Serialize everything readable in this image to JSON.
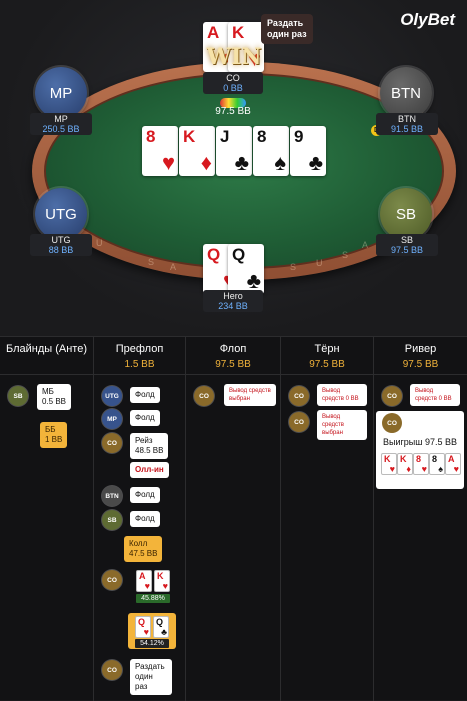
{
  "brand": "OlyBet",
  "table": {
    "win_label": "WIN",
    "deal_once_tip": "Раздать один раз",
    "pot": "97.5 BB",
    "rim_letters": [
      "U",
      "S",
      "A",
      "S",
      "U",
      "S",
      "A"
    ],
    "board": [
      {
        "rank": "8",
        "suit": "♥",
        "color": "red"
      },
      {
        "rank": "K",
        "suit": "♦",
        "color": "red"
      },
      {
        "rank": "J",
        "suit": "♣",
        "color": "black"
      },
      {
        "rank": "8",
        "suit": "♠",
        "color": "black"
      },
      {
        "rank": "9",
        "suit": "♣",
        "color": "black"
      }
    ],
    "co_cards": [
      {
        "rank": "A",
        "suit": "♥",
        "color": "red"
      },
      {
        "rank": "K",
        "suit": "♥",
        "color": "red"
      }
    ],
    "hero_cards": [
      {
        "rank": "Q",
        "suit": "♥",
        "color": "red"
      },
      {
        "rank": "Q",
        "suit": "♣",
        "color": "black"
      }
    ],
    "seats": {
      "co": {
        "name": "CO",
        "stack": "0 BB"
      },
      "mp": {
        "label": "MP",
        "name": "MP",
        "stack": "250.5 BB"
      },
      "btn": {
        "label": "BTN",
        "name": "BTN",
        "stack": "91.5 BB",
        "dealer": "D"
      },
      "utg": {
        "label": "UTG",
        "name": "UTG",
        "stack": "88 BB"
      },
      "sb": {
        "label": "SB",
        "name": "SB",
        "stack": "97.5 BB"
      },
      "hero": {
        "name": "Hero",
        "stack": "234 BB"
      }
    }
  },
  "history": {
    "columns": [
      {
        "title": "Блайнды (Анте)",
        "pot": ""
      },
      {
        "title": "Префлоп",
        "pot": "1.5 BB"
      },
      {
        "title": "Флоп",
        "pot": "97.5 BB"
      },
      {
        "title": "Тёрн",
        "pot": "97.5 BB"
      },
      {
        "title": "Ривер",
        "pot": "97.5 BB"
      }
    ],
    "blinds": {
      "sb_pos": "SB",
      "sb_action": "МБ",
      "sb_amount": "0.5 BB",
      "bb_action": "ББ",
      "bb_amount": "1 BB"
    },
    "preflop": {
      "utg": {
        "pos": "UTG",
        "action": "Фолд"
      },
      "mp": {
        "pos": "MP",
        "action": "Фолд"
      },
      "co": {
        "pos": "CO",
        "action": "Рейз",
        "amount": "48.5 BB",
        "allin": "Олл-ин"
      },
      "btn": {
        "pos": "BTN",
        "action": "Фолд"
      },
      "sb": {
        "pos": "SB",
        "action": "Фолд"
      },
      "hero_call": {
        "action": "Колл",
        "amount": "47.5 BB"
      },
      "co_show": {
        "pos": "CO",
        "cards": [
          {
            "rank": "A",
            "suit": "♥",
            "color": "red"
          },
          {
            "rank": "K",
            "suit": "♥",
            "color": "red"
          }
        ],
        "equity": "45.88%"
      },
      "hero_show": {
        "cards": [
          {
            "rank": "Q",
            "suit": "♥",
            "color": "red"
          },
          {
            "rank": "Q",
            "suit": "♣",
            "color": "black"
          }
        ],
        "equity": "54.12%"
      },
      "co_deal": {
        "pos": "CO",
        "action": "Раздать один раз"
      }
    },
    "flop": {
      "pos": "CO",
      "note": "Вывод средств выбран"
    },
    "turn": {
      "pos1": "CO",
      "note1": "Вывод средств 0 BB",
      "pos2": "CO",
      "note2": "Вывод средств выбран"
    },
    "river": {
      "pos1": "CO",
      "note1": "Вывод средств 0 BB",
      "pos2": "CO",
      "win_text": "Выигрыш 97.5 BB",
      "win_cards": [
        {
          "rank": "K",
          "suit": "♥",
          "color": "red"
        },
        {
          "rank": "K",
          "suit": "♦",
          "color": "red"
        },
        {
          "rank": "8",
          "suit": "♥",
          "color": "red"
        },
        {
          "rank": "8",
          "suit": "♠",
          "color": "black"
        },
        {
          "rank": "A",
          "suit": "♥",
          "color": "red"
        }
      ]
    }
  },
  "colors": {
    "accent_gold": "#f3b43a",
    "stack_blue": "#6fb2ff",
    "felt": "#1f5d35",
    "alert_red": "#c4121a"
  }
}
